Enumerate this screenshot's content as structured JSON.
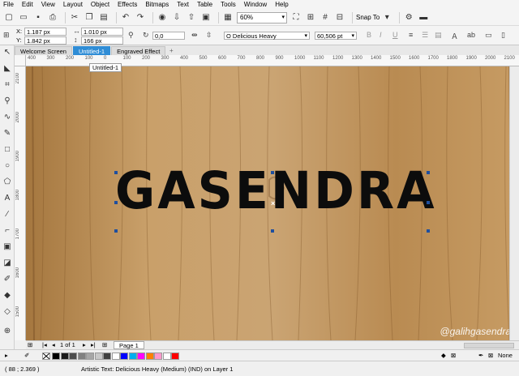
{
  "menubar": {
    "items": [
      "File",
      "Edit",
      "View",
      "Layout",
      "Object",
      "Effects",
      "Bitmaps",
      "Text",
      "Table",
      "Tools",
      "Window",
      "Help"
    ]
  },
  "toolbar": {
    "zoom": "60%",
    "snap_label": "Snap To"
  },
  "propbar": {
    "x_label": "X:",
    "x_value": "1.187 px",
    "y_label": "Y:",
    "y_value": "1.842 px",
    "w_value": "1.010 px",
    "h_value": "166 px",
    "rotation": "0,0",
    "font_name": "Delicious Heavy",
    "font_size": "60,506 pt"
  },
  "tabs": [
    {
      "label": "Welcome Screen",
      "active": false
    },
    {
      "label": "Untitled-1",
      "active": true
    },
    {
      "label": "Engraved Effect",
      "active": false
    }
  ],
  "tooltip": "Untitled-1",
  "ruler_top": [
    "400",
    "300",
    "200",
    "100",
    "0",
    "100",
    "200",
    "300",
    "400",
    "500",
    "600",
    "700",
    "800",
    "900",
    "1000",
    "1100",
    "1200",
    "1300",
    "1400",
    "1500",
    "1600",
    "1700",
    "1800",
    "1900",
    "2000",
    "2100"
  ],
  "ruler_left": [
    "2100",
    "2000",
    "1900",
    "1800",
    "1700",
    "1600",
    "1500"
  ],
  "canvas": {
    "text": "GASENDRA",
    "watermark": "@galihgasendra"
  },
  "bottom_nav": {
    "page_count": "1 of 1",
    "page_tab": "Page 1"
  },
  "palette": {
    "colors": [
      "#000000",
      "#1a1a1a",
      "#4d4d4d",
      "#808080",
      "#a6a6a6",
      "#c8c8c8",
      "#404040",
      "#ffffff",
      "#0000ff",
      "#00aeef",
      "#ff00ff",
      "#ff8000",
      "#ff99cc",
      "#ffffff",
      "#ff0000"
    ],
    "fill_label": "None"
  },
  "status": {
    "coords": "( 88 ; 2.369 )",
    "info": "Artistic Text: Delicious Heavy (Medium) (IND) on Layer 1",
    "fill_none": "None"
  }
}
